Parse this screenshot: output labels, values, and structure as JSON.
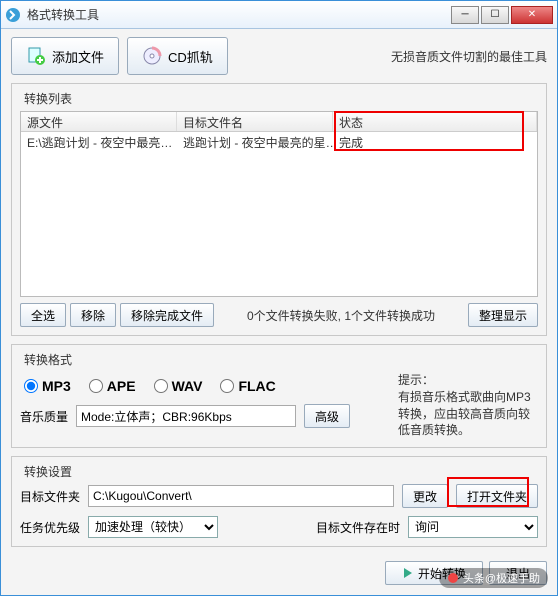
{
  "titlebar": {
    "title": "格式转换工具"
  },
  "toolbar": {
    "add_file": "添加文件",
    "cd_rip": "CD抓轨",
    "tagline": "无损音质文件切割的最佳工具"
  },
  "list": {
    "label": "转换列表",
    "headers": {
      "source": "源文件",
      "target": "目标文件名",
      "status": "状态"
    },
    "rows": [
      {
        "source": "E:\\逃跑计划 - 夜空中最亮…",
        "target": "逃跑计划 - 夜空中最亮的星…",
        "status": "完成"
      }
    ],
    "buttons": {
      "select_all": "全选",
      "remove": "移除",
      "remove_done": "移除完成文件",
      "tidy": "整理显示"
    },
    "status_text": "0个文件转换失败, 1个文件转换成功"
  },
  "format": {
    "label": "转换格式",
    "options": [
      "MP3",
      "APE",
      "WAV",
      "FLAC"
    ],
    "selected": "MP3",
    "hint_title": "提示：",
    "hint_body": "有损音乐格式歌曲向MP3转换，应由较高音质向较低音质转换。",
    "quality_label": "音乐质量",
    "quality_value": "Mode:立体声；CBR:96Kbps",
    "advanced": "高级"
  },
  "settings": {
    "label": "转换设置",
    "folder_label": "目标文件夹",
    "folder_value": "C:\\Kugou\\Convert\\",
    "change": "更改",
    "open_folder": "打开文件夹",
    "priority_label": "任务优先级",
    "priority_value": "加速处理（较快）",
    "exists_label": "目标文件存在时",
    "exists_value": "询问"
  },
  "bottom": {
    "start": "开始转换",
    "exit": "退出"
  },
  "watermark": "头条@极速手助"
}
